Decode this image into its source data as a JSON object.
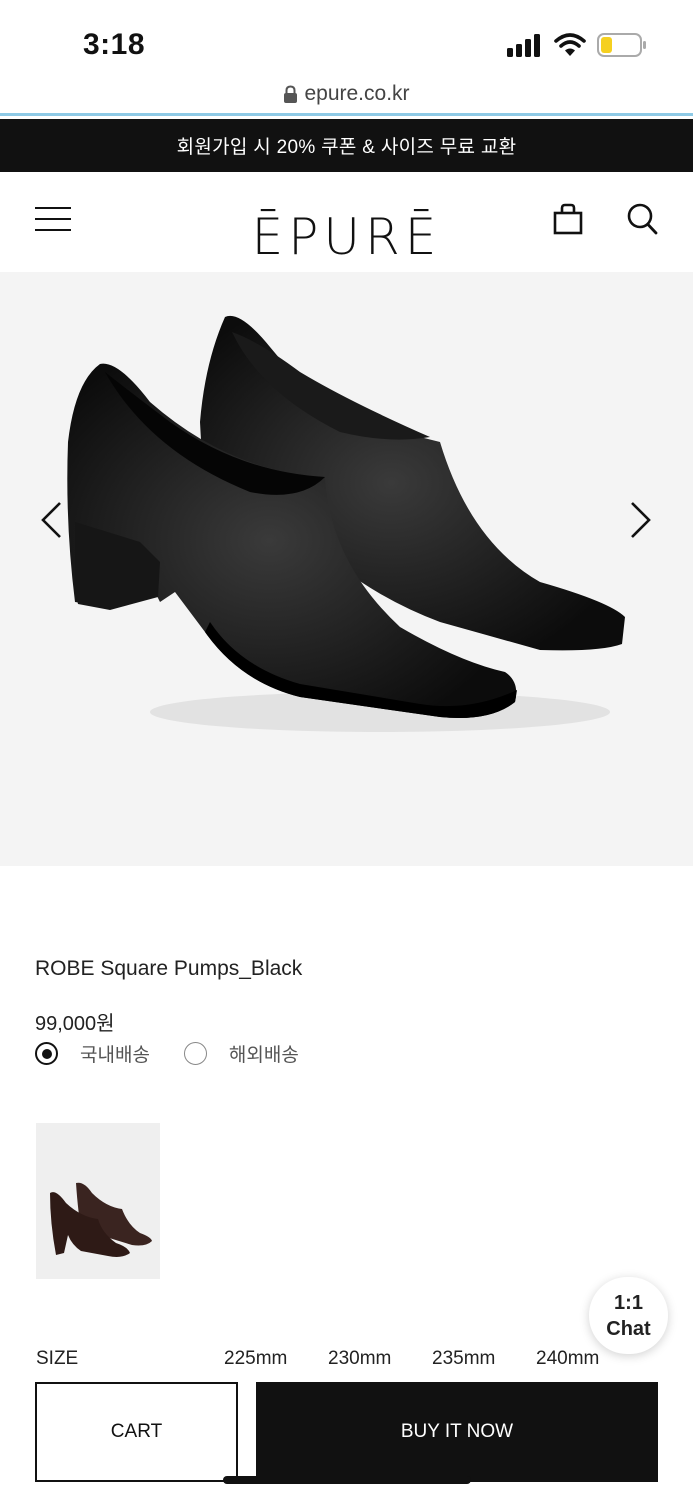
{
  "status_bar": {
    "time": "3:18"
  },
  "browser": {
    "url": "epure.co.kr"
  },
  "promo": {
    "text": "회원가입 시 20% 쿠폰 & 사이즈 무료 교환"
  },
  "header": {
    "logo": "ĒPURĒ"
  },
  "product": {
    "name": "ROBE Square Pumps_Black",
    "price": "99,000원",
    "shipping_options": [
      {
        "label": "국내배송",
        "selected": true
      },
      {
        "label": "해외배송",
        "selected": false
      }
    ],
    "image_color": "#111111",
    "thumbnail_color": "#3a2420"
  },
  "chat": {
    "line1": "1:1",
    "line2": "Chat"
  },
  "size": {
    "label": "SIZE",
    "options": [
      "225mm",
      "230mm",
      "235mm",
      "240mm"
    ]
  },
  "actions": {
    "cart": "CART",
    "buy_now": "BUY IT NOW"
  },
  "icons": {
    "menu": "hamburger-menu-icon",
    "cart": "shopping-bag-icon",
    "search": "search-icon",
    "prev": "chevron-left-icon",
    "next": "chevron-right-icon",
    "lock": "lock-icon"
  },
  "colors": {
    "banner_bg": "#111111",
    "url_accent": "#8ecae6",
    "battery_level": "#f5d020"
  }
}
